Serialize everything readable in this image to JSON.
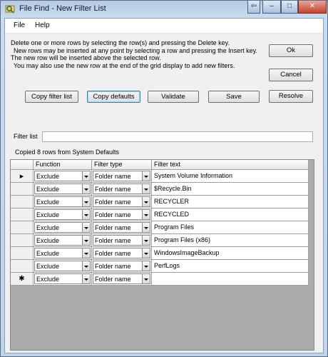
{
  "window": {
    "title": "File Find - New Filter List",
    "controls": {
      "back": "⇦",
      "minimize": "–",
      "maximize": "□",
      "close": "✕"
    }
  },
  "menu": [
    {
      "label": "File"
    },
    {
      "label": "Help"
    }
  ],
  "instructions": [
    "Delete one or more rows by selecting the row(s) and pressing the Delete key.",
    "New rows may be inserted at any point by selecting a row and pressing the Insert key.",
    "The new row will be inserted above the selected row.",
    "You may also use the new row at the end of the grid display to add new filters."
  ],
  "buttons": {
    "ok": "Ok",
    "cancel": "Cancel",
    "copy_filter_list": "Copy filter list",
    "copy_defaults": "Copy defaults",
    "validate": "Validate",
    "save": "Save",
    "resolve": "Resolve"
  },
  "filter_list": {
    "label": "Filter list",
    "value": ""
  },
  "status": "Copied 8 rows from System Defaults",
  "grid": {
    "headers": {
      "function": "Function",
      "filter_type": "Filter type",
      "filter_text": "Filter text"
    },
    "current_row_marker": "▶",
    "new_row_marker": "✱",
    "rows": [
      {
        "function": "Exclude",
        "filter_type": "Folder name",
        "filter_text": "System Volume Information"
      },
      {
        "function": "Exclude",
        "filter_type": "Folder name",
        "filter_text": "$Recycle.Bin"
      },
      {
        "function": "Exclude",
        "filter_type": "Folder name",
        "filter_text": "RECYCLER"
      },
      {
        "function": "Exclude",
        "filter_type": "Folder name",
        "filter_text": "RECYCLED"
      },
      {
        "function": "Exclude",
        "filter_type": "Folder name",
        "filter_text": "Program Files"
      },
      {
        "function": "Exclude",
        "filter_type": "Folder name",
        "filter_text": "Program Files (x86)"
      },
      {
        "function": "Exclude",
        "filter_type": "Folder name",
        "filter_text": "WindowsImageBackup"
      },
      {
        "function": "Exclude",
        "filter_type": "Folder name",
        "filter_text": "PerfLogs"
      }
    ],
    "new_row": {
      "function": "Exclude",
      "filter_type": "Folder name",
      "filter_text": ""
    }
  }
}
